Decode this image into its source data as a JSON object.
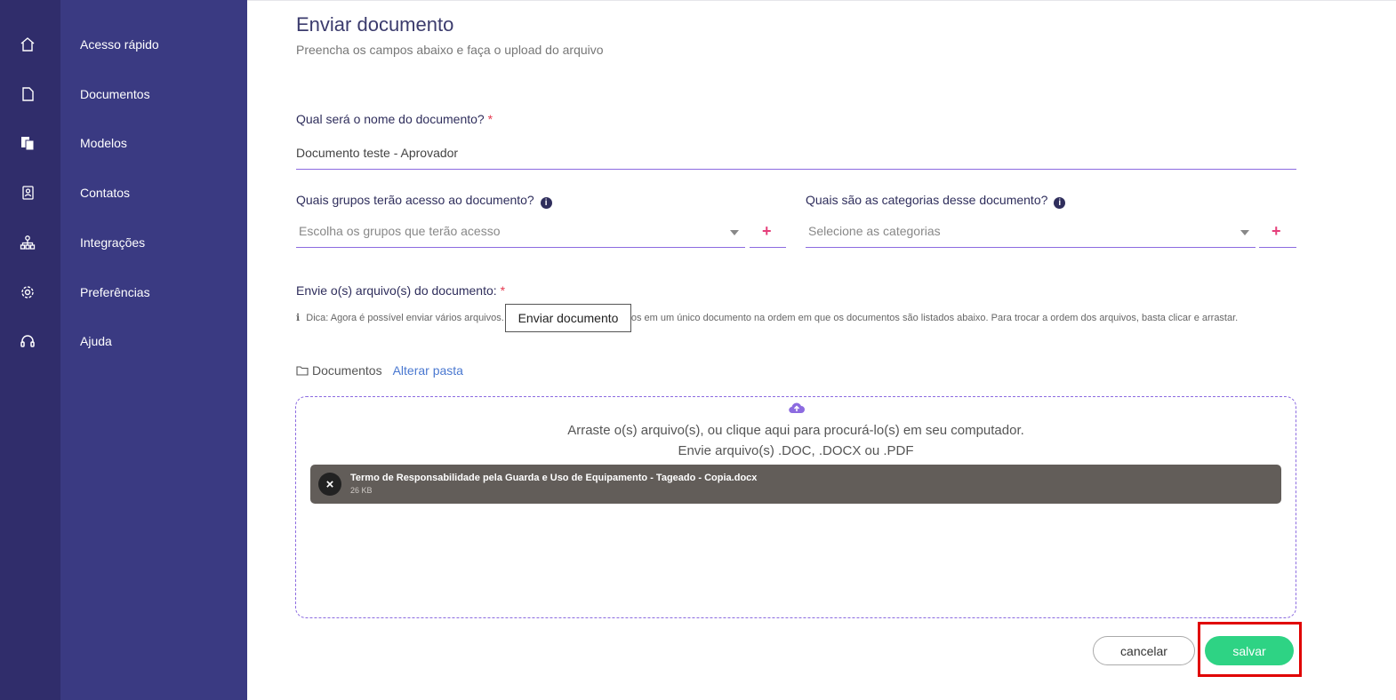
{
  "sidebar": {
    "items": [
      {
        "label": "Acesso rápido",
        "icon": "home-icon"
      },
      {
        "label": "Documentos",
        "icon": "document-icon"
      },
      {
        "label": "Modelos",
        "icon": "templates-icon"
      },
      {
        "label": "Contatos",
        "icon": "contacts-icon"
      },
      {
        "label": "Integrações",
        "icon": "integrations-icon"
      },
      {
        "label": "Preferências",
        "icon": "gear-icon"
      },
      {
        "label": "Ajuda",
        "icon": "headset-icon"
      }
    ]
  },
  "page": {
    "title": "Enviar documento",
    "subtitle": "Preencha os campos abaixo e faça o upload do arquivo"
  },
  "form": {
    "name_label": "Qual será o nome do documento?",
    "required_mark": "*",
    "name_value": "Documento teste - Aprovador",
    "groups_label": "Quais grupos terão acesso ao documento?",
    "groups_placeholder": "Escolha os grupos que terão acesso",
    "categories_label": "Quais são as categorias desse documento?",
    "categories_placeholder": "Selecione as categorias",
    "add_symbol": "+",
    "info_symbol": "i",
    "files_label": "Envie o(s) arquivo(s) do documento:",
    "tip_icon": "ℹ",
    "tip_text": "Dica: Agora é possível enviar vários arquivos. Os arquivos serão combinados em um único documento na ordem em que os documentos são listados abaixo. Para trocar a ordem dos arquivos, basta clicar e arrastar.",
    "tooltip": "Enviar documento",
    "folder_name": "Documentos",
    "change_folder": "Alterar pasta"
  },
  "dropzone": {
    "line1": "Arraste o(s) arquivo(s), ou clique aqui para procurá-lo(s) em seu computador.",
    "line2": "Envie arquivo(s) .DOC, .DOCX ou .PDF"
  },
  "file": {
    "name": "Termo de Responsabilidade pela Guarda e Uso de Equipamento - Tageado - Copia.docx",
    "size": "26 KB",
    "remove": "×"
  },
  "actions": {
    "cancel": "cancelar",
    "save": "salvar"
  },
  "colors": {
    "sidebar_dark": "#302d6b",
    "sidebar": "#3a3a82",
    "accent": "#8c6be0",
    "save": "#2ed384",
    "plus": "#e53e7a",
    "highlight": "#e00000"
  }
}
